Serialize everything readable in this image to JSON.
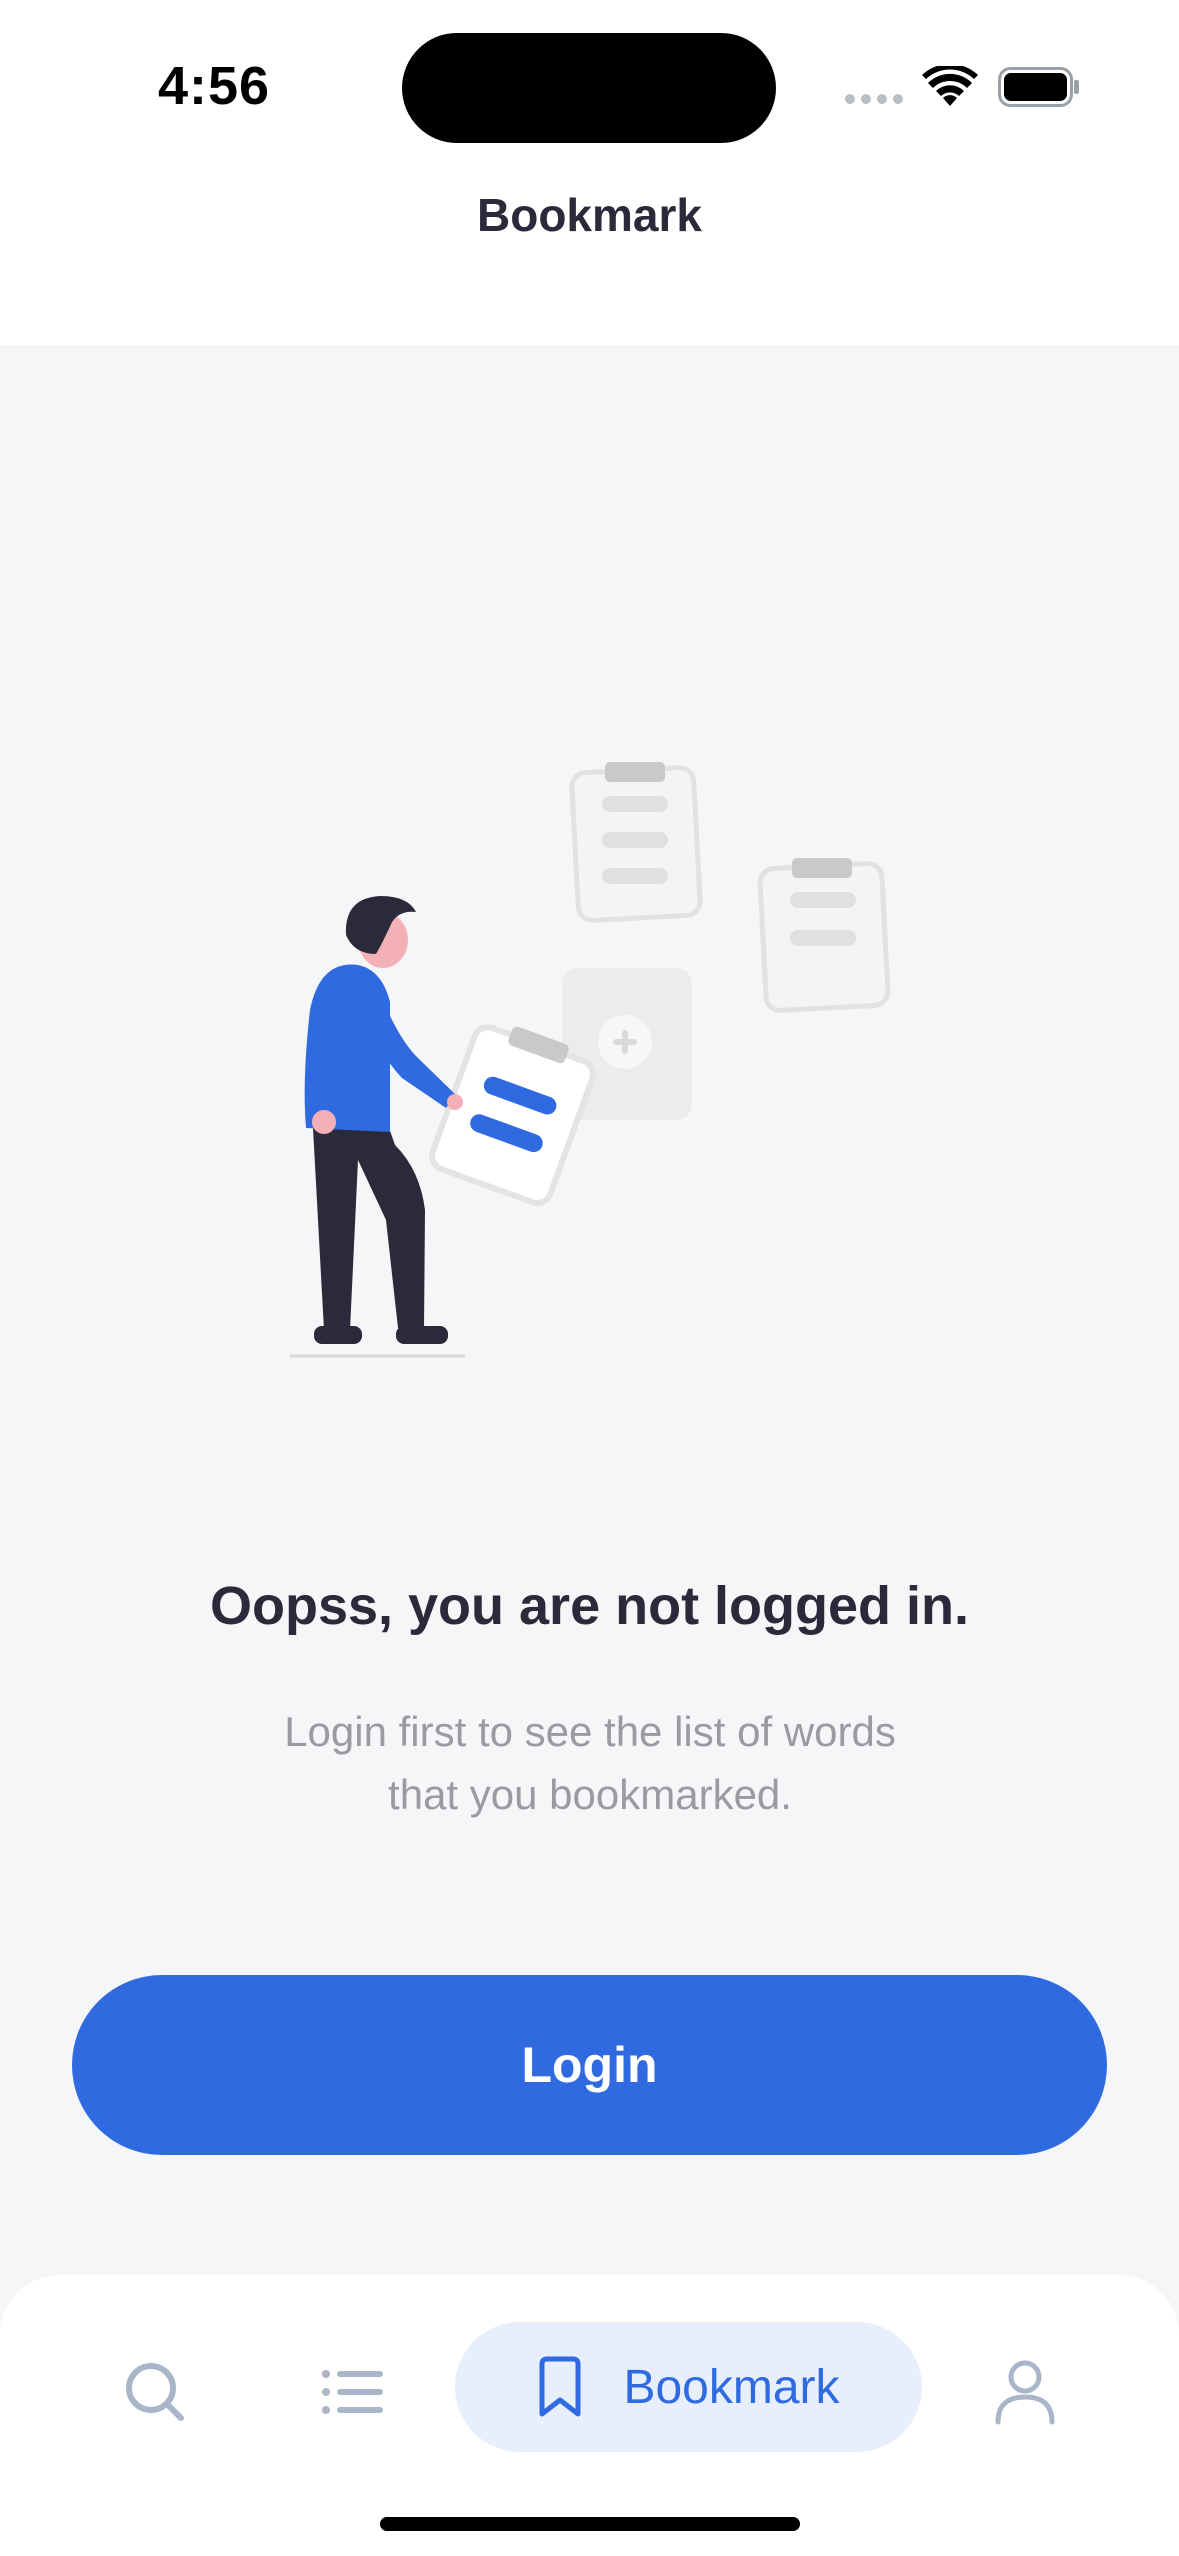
{
  "status_bar": {
    "time": "4:56",
    "icons": [
      "cellular-signal-icon",
      "wifi-icon",
      "battery-icon"
    ]
  },
  "header": {
    "title": "Bookmark"
  },
  "empty_state": {
    "illustration": "person-with-clipboards-illustration",
    "title": "Oopss, you are not logged in.",
    "description_line1": "Login first to see the list of words",
    "description_line2": "that you bookmarked."
  },
  "login_button": {
    "label": "Login"
  },
  "tab_bar": {
    "tabs": [
      {
        "icon": "search-icon",
        "label": "",
        "active": false
      },
      {
        "icon": "list-icon",
        "label": "",
        "active": false
      },
      {
        "icon": "bookmark-icon",
        "label": "Bookmark",
        "active": true
      },
      {
        "icon": "profile-icon",
        "label": "",
        "active": false
      }
    ]
  },
  "colors": {
    "accent": "#2f6ae0",
    "accent_light": "#e7eefc",
    "background": "#f5f6f8",
    "text_primary": "#2b2a3a",
    "text_secondary": "#9a9aa2",
    "tab_inactive": "#a9b5c8"
  }
}
